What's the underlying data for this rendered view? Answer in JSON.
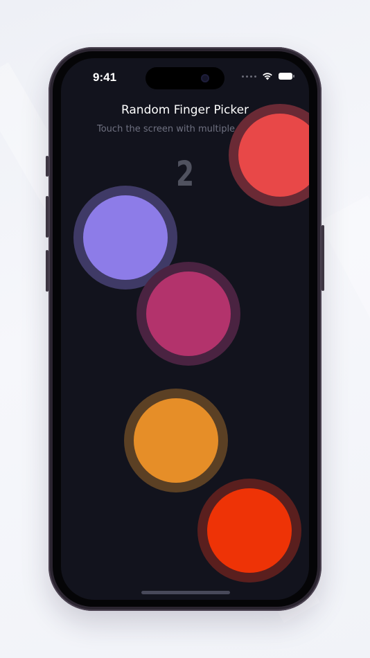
{
  "status_bar": {
    "time": "9:41"
  },
  "app": {
    "title": "Random Finger Picker",
    "subtitle": "Touch the screen with multiple fingers",
    "count": "2"
  },
  "fingers": [
    {
      "name": "red",
      "color": "#e84848",
      "ring": "#6a2a35"
    },
    {
      "name": "purple",
      "color": "#8d7ce8",
      "ring": "#3f3a66"
    },
    {
      "name": "magenta",
      "color": "#b3336c",
      "ring": "#4a2341"
    },
    {
      "name": "orange",
      "color": "#e68e28",
      "ring": "#5b4024"
    },
    {
      "name": "red-orange",
      "color": "#ee3306",
      "ring": "#5a1f1e"
    }
  ]
}
